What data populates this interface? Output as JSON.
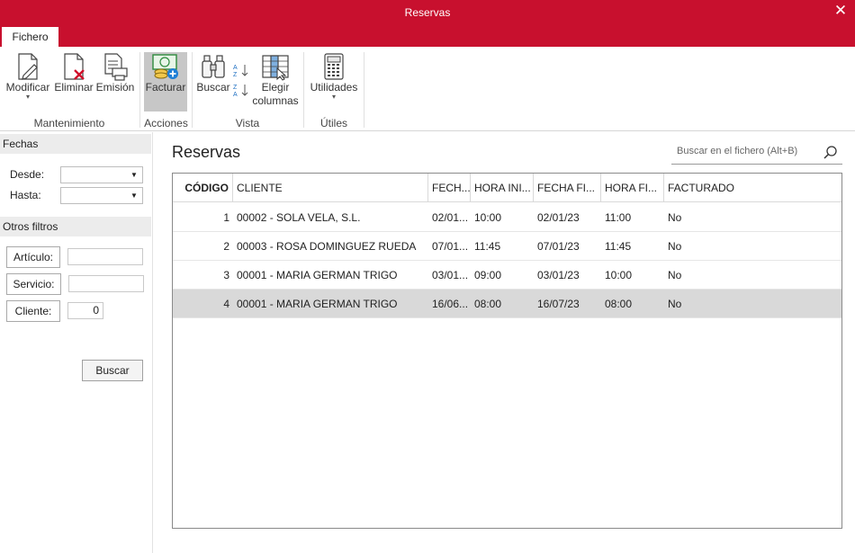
{
  "window": {
    "title": "Reservas"
  },
  "tabs": [
    {
      "label": "Fichero"
    }
  ],
  "ribbon": {
    "buttons": {
      "modificar": "Modificar",
      "eliminar": "Eliminar",
      "emision": "Emisión",
      "facturar": "Facturar",
      "buscar": "Buscar",
      "elegir_line1": "Elegir",
      "elegir_line2": "columnas",
      "utilidades": "Utilidades"
    },
    "groups": {
      "mantenimiento": "Mantenimiento",
      "acciones": "Acciones",
      "vista": "Vista",
      "utiles": "Útiles"
    }
  },
  "filters": {
    "fechas_header": "Fechas",
    "desde_label": "Desde:",
    "hasta_label": "Hasta:",
    "desde_value": "",
    "hasta_value": "",
    "otros_header": "Otros filtros",
    "articulo_label": "Artículo:",
    "servicio_label": "Servicio:",
    "cliente_label": "Cliente:",
    "articulo_value": "",
    "servicio_value": "",
    "cliente_value": "0",
    "buscar_button": "Buscar"
  },
  "main": {
    "title": "Reservas",
    "search_placeholder": "Buscar en el fichero (Alt+B)"
  },
  "table": {
    "columns": [
      "CÓDIGO",
      "CLIENTE",
      "FECH...",
      "HORA INI...",
      "FECHA FI...",
      "HORA FI...",
      "FACTURADO"
    ],
    "rows": [
      [
        "1",
        "00002 - SOLA VELA, S.L.",
        "02/01...",
        "10:00",
        "02/01/23",
        "11:00",
        "No"
      ],
      [
        "2",
        "00003 - ROSA DOMINGUEZ RUEDA",
        "07/01...",
        "11:45",
        "07/01/23",
        "11:45",
        "No"
      ],
      [
        "3",
        "00001 - MARIA GERMAN TRIGO",
        "03/01...",
        "09:00",
        "03/01/23",
        "10:00",
        "No"
      ],
      [
        "4",
        "00001 - MARIA GERMAN TRIGO",
        "16/06...",
        "08:00",
        "16/07/23",
        "08:00",
        "No"
      ]
    ],
    "selected_row": 4
  },
  "colors": {
    "brand": "#c8102e",
    "selected_row": "#d9d9d9"
  }
}
